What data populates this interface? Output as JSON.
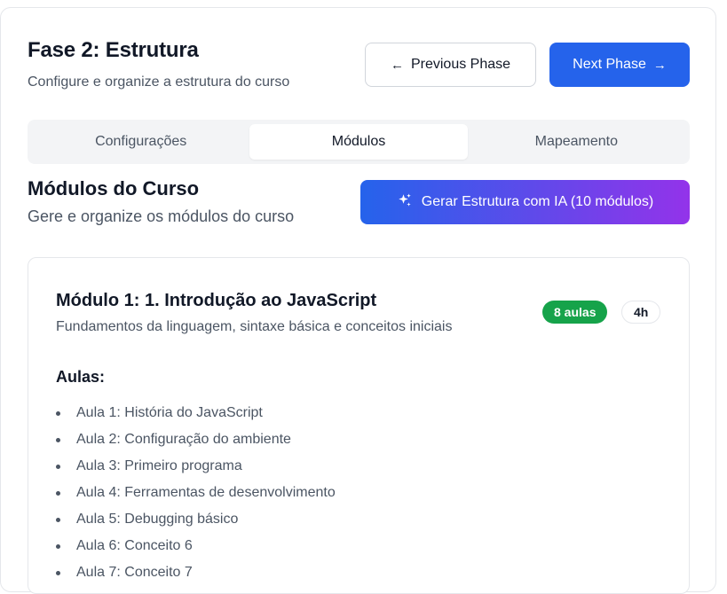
{
  "header": {
    "title": "Fase 2: Estrutura",
    "subtitle": "Configure e organize a estrutura do curso",
    "prev_label": "Previous Phase",
    "next_label": "Next Phase",
    "prev_icon": "arrow-left-icon",
    "next_icon": "arrow-right-icon"
  },
  "tabs": [
    {
      "label": "Configurações",
      "active": false
    },
    {
      "label": "Módulos",
      "active": true
    },
    {
      "label": "Mapeamento",
      "active": false
    }
  ],
  "section": {
    "title": "Módulos do Curso",
    "subtitle": "Gere e organize os módulos do curso",
    "ai_button_label": "Gerar Estrutura com IA (10 módulos)",
    "ai_icon": "sparkles-icon"
  },
  "module": {
    "title": "Módulo 1: 1. Introdução ao JavaScript",
    "description": "Fundamentos da linguagem, sintaxe básica e conceitos iniciais",
    "lessons_badge": "8 aulas",
    "hours_badge": "4h",
    "lessons_heading": "Aulas:",
    "lessons": [
      "Aula 1: História do JavaScript",
      "Aula 2: Configuração do ambiente",
      "Aula 3: Primeiro programa",
      "Aula 4: Ferramentas de desenvolvimento",
      "Aula 5: Debugging básico",
      "Aula 6: Conceito 6",
      "Aula 7: Conceito 7"
    ]
  },
  "colors": {
    "primary": "#2563eb",
    "gradient_end": "#9333ea",
    "success": "#16a34a",
    "muted_text": "#4b5563",
    "border": "#e5e7eb"
  }
}
